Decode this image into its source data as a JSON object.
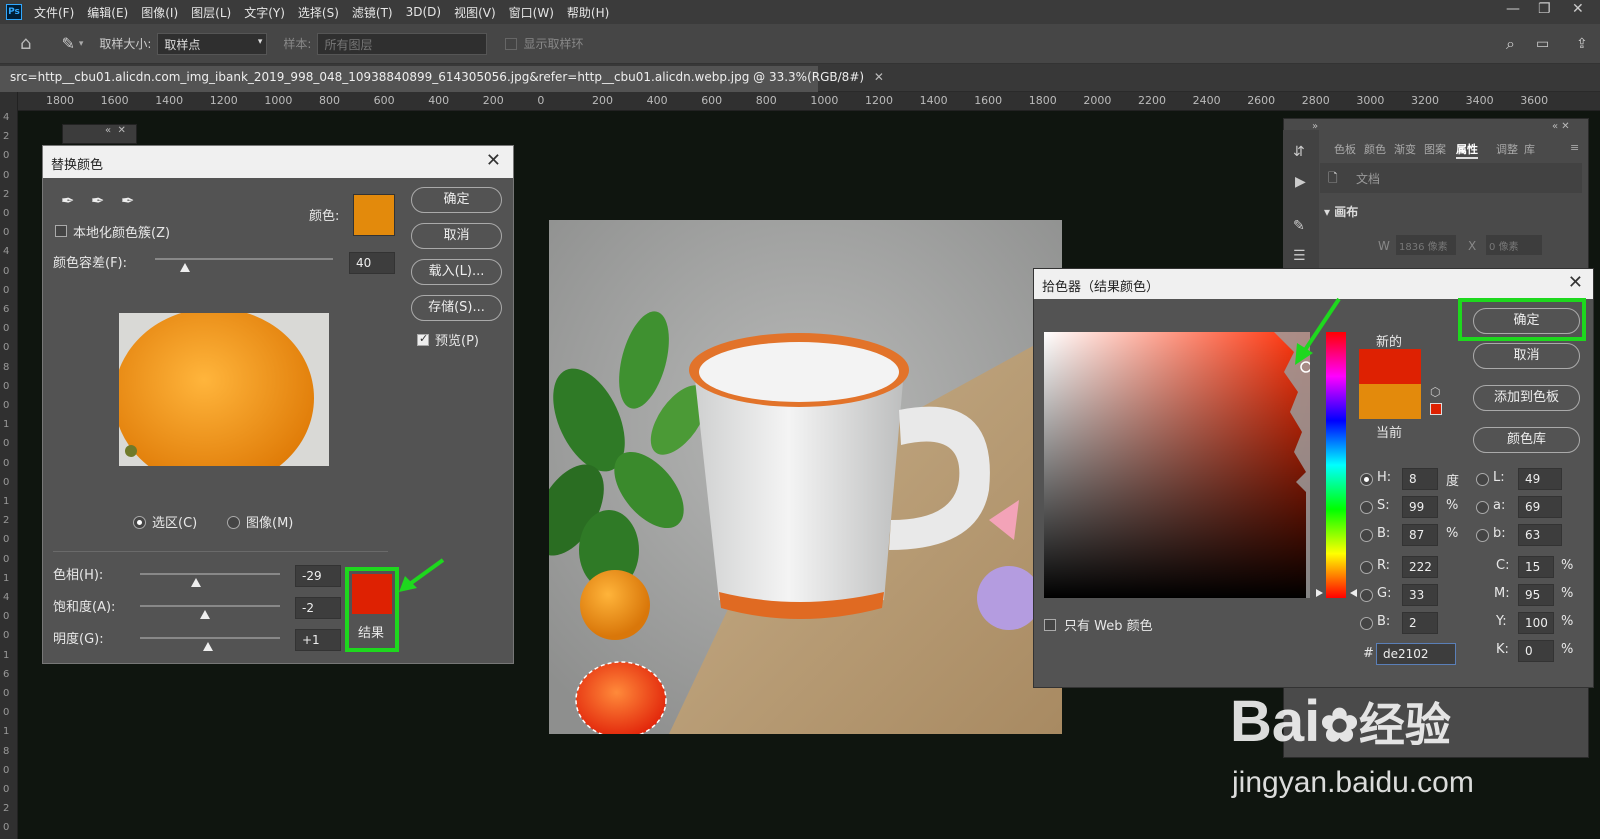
{
  "app": {
    "logo": "Ps"
  },
  "menu": [
    "文件(F)",
    "编辑(E)",
    "图像(I)",
    "图层(L)",
    "文字(Y)",
    "选择(S)",
    "滤镜(T)",
    "3D(D)",
    "视图(V)",
    "窗口(W)",
    "帮助(H)"
  ],
  "options_bar": {
    "sample_size_label": "取样大小:",
    "sample_size_value": "取样点",
    "sample_label": "样本:",
    "sample_value": "所有图层",
    "show_ring_label": "显示取样环"
  },
  "document_tab": {
    "title": "src=http__cbu01.alicdn.com_img_ibank_2019_998_048_10938840899_614305056.jpg&refer=http__cbu01.alicdn.webp.jpg @ 33.3%(RGB/8#)"
  },
  "ruler_top": [
    "1800",
    "1600",
    "1400",
    "1200",
    "1000",
    "800",
    "600",
    "400",
    "200",
    "0",
    "200",
    "400",
    "600",
    "800",
    "1000",
    "1200",
    "1400",
    "1600",
    "1800",
    "2000",
    "2200",
    "2400",
    "2600",
    "2800",
    "3000",
    "3200",
    "3400",
    "3600"
  ],
  "ruler_left": [
    "4",
    "2",
    "0",
    "0",
    "2",
    "0",
    "0",
    "4",
    "0",
    "0",
    "6",
    "0",
    "0",
    "8",
    "0",
    "0",
    "1",
    "0",
    "0",
    "0",
    "1",
    "2",
    "0",
    "0",
    "1",
    "4",
    "0",
    "0",
    "1",
    "6",
    "0",
    "0",
    "1",
    "8",
    "0",
    "0",
    "2",
    "0"
  ],
  "replace_color": {
    "title": "替换颜色",
    "localized_label": "本地化颜色簇(Z)",
    "color_label": "颜色:",
    "color_swatch": "#e38a0c",
    "fuzziness_label": "颜色容差(F):",
    "fuzziness_value": "40",
    "fuzziness_fraction": 0.17,
    "ok": "确定",
    "cancel": "取消",
    "load": "载入(L)...",
    "save": "存储(S)...",
    "preview_label": "预览(P)",
    "selection_label": "选区(C)",
    "image_label": "图像(M)",
    "hue_label": "色相(H):",
    "hue_value": "-29",
    "saturation_label": "饱和度(A):",
    "saturation_value": "-2",
    "lightness_label": "明度(G):",
    "lightness_value": "+1",
    "result_label": "结果",
    "result_color": "#de2102"
  },
  "color_picker": {
    "title": "拾色器（结果颜色）",
    "ok": "确定",
    "cancel": "取消",
    "add_swatch": "添加到色板",
    "color_libraries": "颜色库",
    "new_label": "新的",
    "current_label": "当前",
    "new_color": "#de2102",
    "current_color": "#e38a0c",
    "web_only_label": "只有 Web 颜色",
    "fields": {
      "H": {
        "label": "H:",
        "value": "8",
        "unit": "度"
      },
      "S": {
        "label": "S:",
        "value": "99",
        "unit": "%"
      },
      "Bv": {
        "label": "B:",
        "value": "87",
        "unit": "%"
      },
      "R": {
        "label": "R:",
        "value": "222"
      },
      "G": {
        "label": "G:",
        "value": "33"
      },
      "Bl": {
        "label": "B:",
        "value": "2"
      },
      "L": {
        "label": "L:",
        "value": "49"
      },
      "a": {
        "label": "a:",
        "value": "69"
      },
      "b": {
        "label": "b:",
        "value": "63"
      },
      "C": {
        "label": "C:",
        "value": "15",
        "unit": "%"
      },
      "M": {
        "label": "M:",
        "value": "95",
        "unit": "%"
      },
      "Y": {
        "label": "Y:",
        "value": "100",
        "unit": "%"
      },
      "K": {
        "label": "K:",
        "value": "0",
        "unit": "%"
      }
    },
    "hash": "#",
    "hex_value": "de2102"
  },
  "right_panel": {
    "tabs": [
      "色板",
      "颜色",
      "渐变",
      "图案",
      "属性",
      "调整",
      "库"
    ],
    "active_tab": "属性",
    "doc_label": "文档",
    "canvas_section": "画布",
    "w_label": "W",
    "w_value": "1836 像素",
    "x_label": "X",
    "x_value": "0 像素"
  },
  "watermark": {
    "brand": "Bai",
    "brand2": "经验",
    "url": "jingyan.baidu.com"
  },
  "accent_green": "#1ed81e"
}
